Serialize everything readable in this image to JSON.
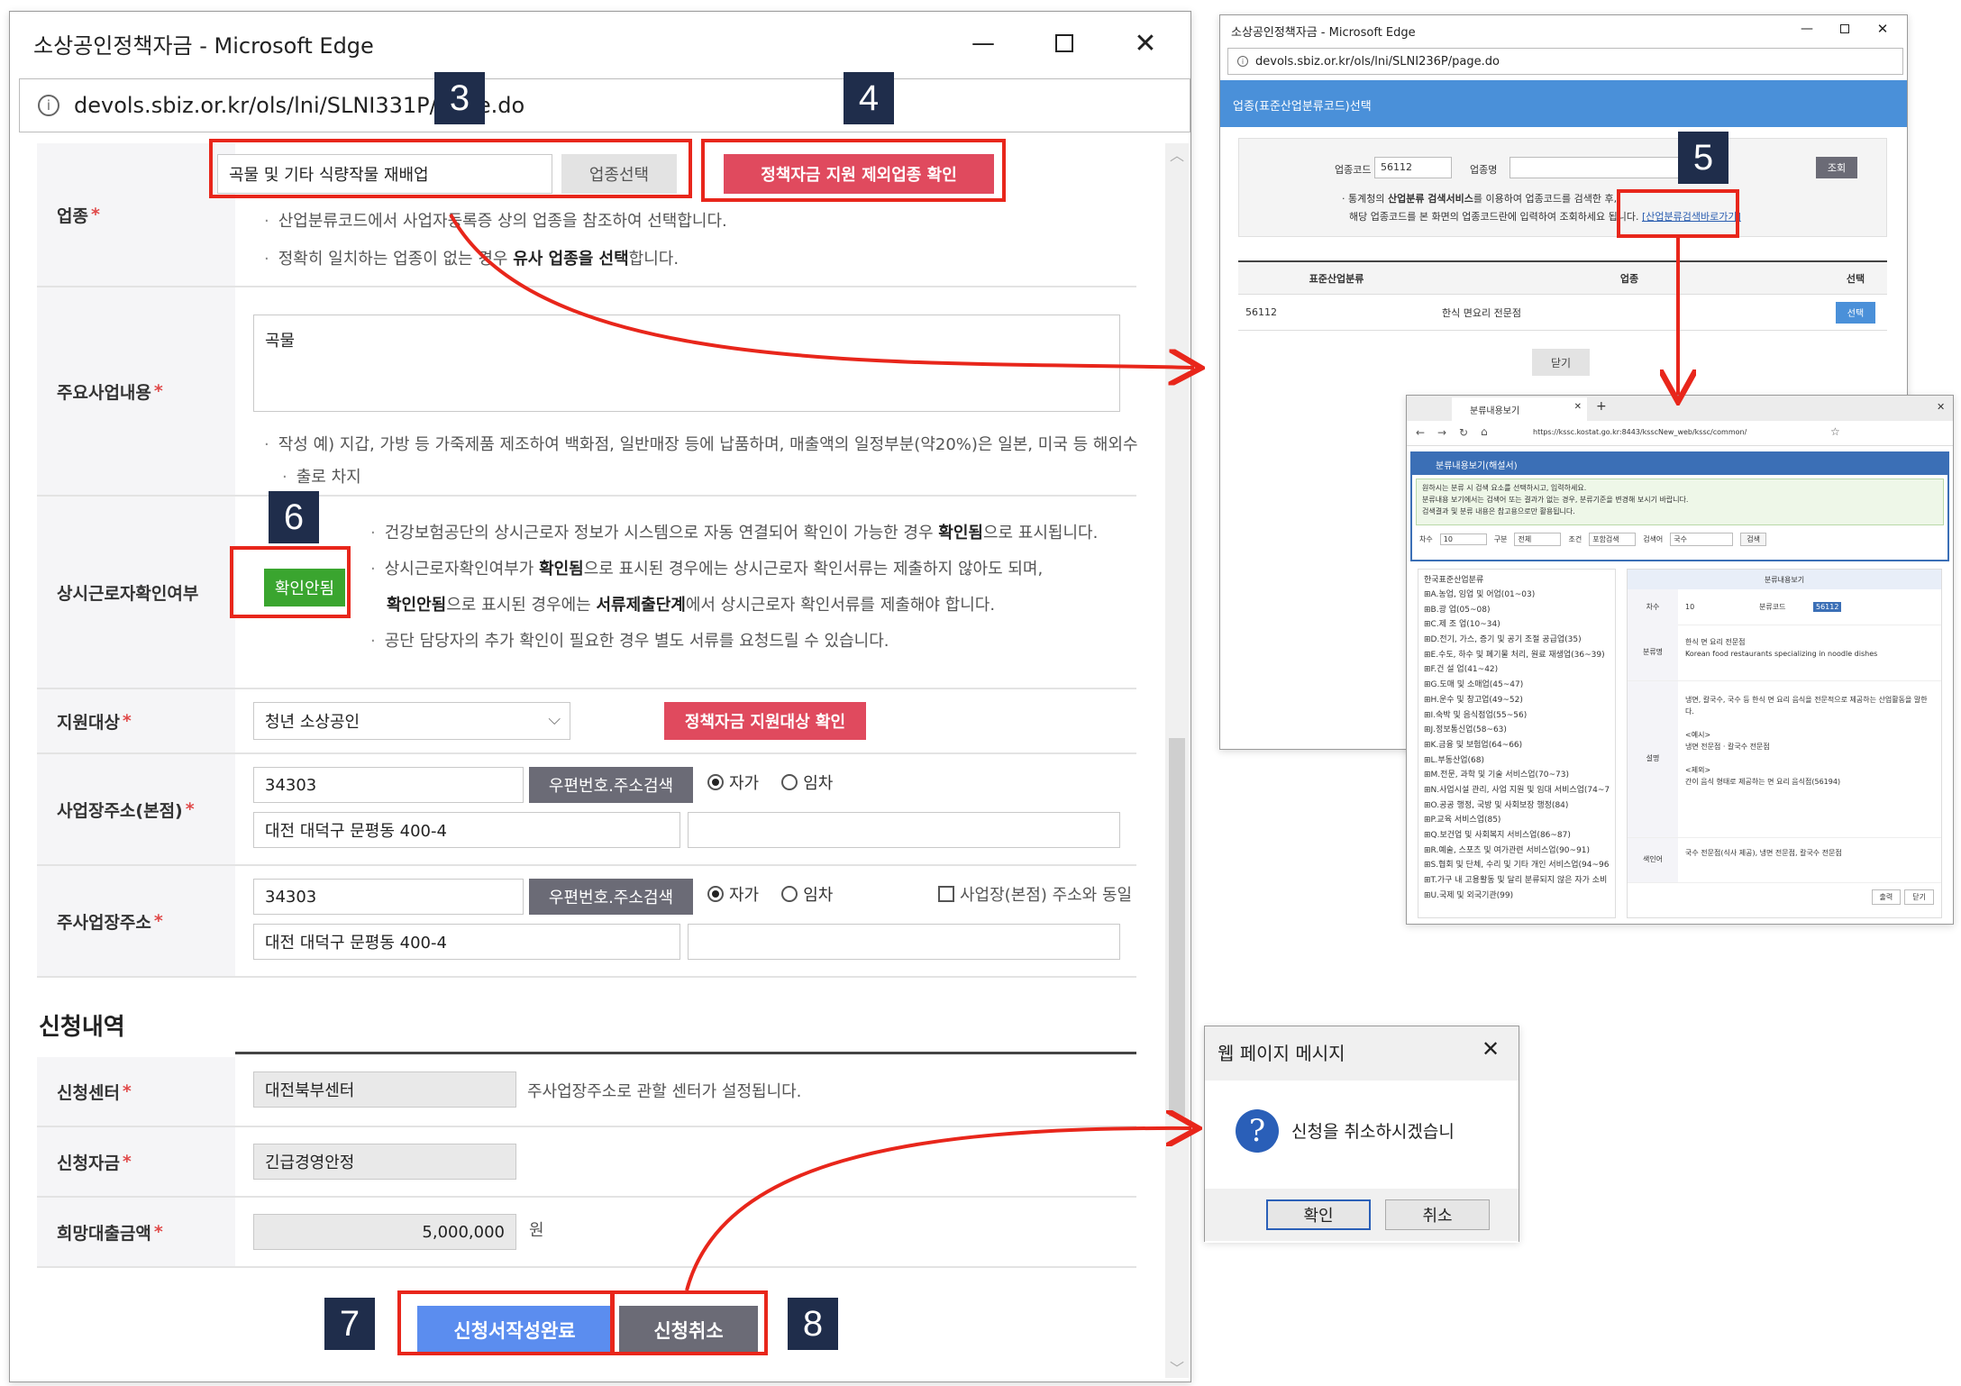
{
  "main_window": {
    "title": "소상공인정책자금 - Microsoft Edge",
    "url": "devols.sbiz.or.kr/ols/lni/SLNI331P/page.do",
    "industry": {
      "label": "업종",
      "value": "곡물 및 기타 식량작물 재배업",
      "select_btn": "업종선택",
      "exclude_btn": "정책자금 지원 제외업종 확인",
      "note1": "산업분류코드에서 사업자등록증 상의 업종을 참조하여 선택합니다.",
      "note2_a": "정확히 일치하는 업종이 없는 경우 ",
      "note2_b": "유사 업종을 선택",
      "note2_c": "합니다."
    },
    "business": {
      "label": "주요사업내용",
      "value": "곡물",
      "note_line1": "작성 예) 지갑, 가방 등 가죽제품 제조하여 백화점, 일반매장 등에 납품하며, 매출액의 일정부분(약20%)은 일본, 미국 등 해외수",
      "note_line2": "출로 차지"
    },
    "worker": {
      "label": "상시근로자확인여부",
      "btn": "확인안됨",
      "n1_a": "건강보험공단의 상시근로자 정보가 시스템으로 자동 연결되어 확인이 가능한 경우 ",
      "n1_b": "확인됨",
      "n1_c": "으로 표시됩니다.",
      "n2_a": "상시근로자확인여부가 ",
      "n2_b": "확인됨",
      "n2_c": "으로 표시된 경우에는 상시근로자 확인서류는 제출하지 않아도 되며,",
      "n3_a": "확인안됨",
      "n3_b": "으로 표시된 경우에는 ",
      "n3_c": "서류제출단계",
      "n3_d": "에서 상시근로자 확인서류를 제출해야 합니다.",
      "n4": "공단 담당자의 추가 확인이 필요한 경우 별도 서류를 요청드릴 수 있습니다."
    },
    "target": {
      "label": "지원대상",
      "value": "청년 소상공인",
      "btn": "정책자금 지원대상 확인"
    },
    "hq_addr": {
      "label": "사업장주소(본점)",
      "zip": "34303",
      "search_btn": "우편번호.주소검색",
      "own": "자가",
      "rent": "임차",
      "addr": "대전 대덕구 문평동 400-4"
    },
    "main_addr": {
      "label": "주사업장주소",
      "zip": "34303",
      "search_btn": "우편번호.주소검색",
      "own": "자가",
      "rent": "임차",
      "same": "사업장(본점) 주소와 동일",
      "addr": "대전 대덕구 문평동 400-4"
    },
    "section_title": "신청내역",
    "center": {
      "label": "신청센터",
      "value": "대전북부센터",
      "note": "주사업장주소로 관할 센터가 설정됩니다."
    },
    "fund": {
      "label": "신청자금",
      "value": "긴급경영안정"
    },
    "amount": {
      "label": "희망대출금액",
      "value": "5,000,000",
      "unit": "원"
    },
    "submit_btn": "신청서작성완료",
    "cancel_btn": "신청취소"
  },
  "markers": {
    "m3": "3",
    "m4": "4",
    "m5": "5",
    "m6": "6",
    "m7": "7",
    "m8": "8"
  },
  "popup": {
    "title": "소상공인정책자금 - Microsoft Edge",
    "url": "devols.sbiz.or.kr/ols/lni/SLNI236P/page.do",
    "header": "업종(표준산업분류코드)선택",
    "code_label": "업종코드",
    "code_value": "56112",
    "name_label": "업종명",
    "search_btn": "조회",
    "note1_a": "통계청의 ",
    "note1_b": "산업분류 검색서비스",
    "note1_c": "를 이용하여 업종코드를 검색한 후,",
    "note2": "해당 업종코드를 본 화면의 업종코드란에 입력하여 조회하세요 됩니다.",
    "link": "[산업분류검색바로가기]",
    "th": [
      "표준산업분류",
      "업종",
      "선택"
    ],
    "row": {
      "code": "56112",
      "name": "한식 면요리 전문점",
      "btn": "선택"
    },
    "close_btn": "닫기"
  },
  "kssc": {
    "tab": "분류내용보기",
    "url": "https://kssc.kostat.go.kr:8443/ksscNew_web/kssc/common/",
    "panel_title": "분류내용보기(해설서)",
    "info1": "원하시는 분류 시 검색 요소를 선택하시고, 입력하세요.",
    "info2": "분류내용 보기에서는 검색어 또는 결과가 없는 경우, 분류기준을 변경해 보시기 바랍니다.",
    "info3": "검색결과 및 분류 내용은 참고용으로만 활용됩니다.",
    "f_cha": "차수",
    "f_cha_v": "10",
    "f_gu": "구분",
    "f_gu_v": "전체",
    "f_jo": "조건",
    "f_jo_v": "포함검색",
    "f_kw": "검색어",
    "f_kw_v": "국수",
    "f_btn": "검색",
    "tree_root": "한국표준산업분류",
    "tree": [
      "A.농업, 임업 및 어업(01~03)",
      "B.광 업(05~08)",
      "C.제 조 업(10~34)",
      "D.전기, 가스, 증기 및 공기 조절 공급업(35)",
      "E.수도, 하수 및 폐기물 처리, 원료 재생업(36~39)",
      "F.건 설 업(41~42)",
      "G.도매 및 소매업(45~47)",
      "H.운수 및 창고업(49~52)",
      "I.숙박 및 음식점업(55~56)",
      "J.정보통신업(58~63)",
      "K.금융 및 보험업(64~66)",
      "L.부동산업(68)",
      "M.전문, 과학 및 기술 서비스업(70~73)",
      "N.사업시설 관리, 사업 지원 및 임대 서비스업(74~76)",
      "O.공공 행정, 국방 및 사회보장 행정(84)",
      "P.교육 서비스업(85)",
      "Q.보건업 및 사회복지 서비스업(86~87)",
      "R.예술, 스포츠 및 여가관련 서비스업(90~91)",
      "S.협회 및 단체, 수리 및 기타 개인 서비스업(94~96)",
      "T.가구 내 고용활동 및 달리 분류되지 않은 자가 소비 생산활동(97~98)",
      "U.국제 및 외국기관(99)"
    ],
    "detail_title": "분류내용보기",
    "d_cha": "차수",
    "d_cha_v": "10",
    "d_code": "분류코드",
    "d_code_v": "56112",
    "d_name": "분류명",
    "d_name_v": "한식 면 요리 전문점",
    "d_name_en": "Korean food restaurants specializing in noodle dishes",
    "d_desc": "설명",
    "d_desc_v": "냉면, 칼국수, 국수 등 한식 면 요리 음식을 전문적으로 제공하는 산업활동을 말한다.",
    "d_ex1": "<예시>",
    "d_ex1_v": "냉면 전문점 · 칼국수 전문점",
    "d_ex2": "<제외>",
    "d_ex2_v": "간이 음식 형태로 제공하는 면 요리 음식점(56194)",
    "d_kw": "색인어",
    "d_kw_v": "국수 전문점(식사 제공), 냉면 전문점, 칼국수 전문점",
    "print_btn": "출력",
    "close_btn": "닫기"
  },
  "dialog": {
    "title": "웹 페이지 메시지",
    "message": "신청을 취소하시겠습니",
    "ok": "확인",
    "cancel": "취소"
  },
  "colors": {
    "red_btn": "#e04a5e",
    "green": "#3aa52f",
    "blue_btn": "#5b8def",
    "dark_btn": "#6b6b76",
    "annot": "#e8261b",
    "marker": "#1f2d4b"
  }
}
